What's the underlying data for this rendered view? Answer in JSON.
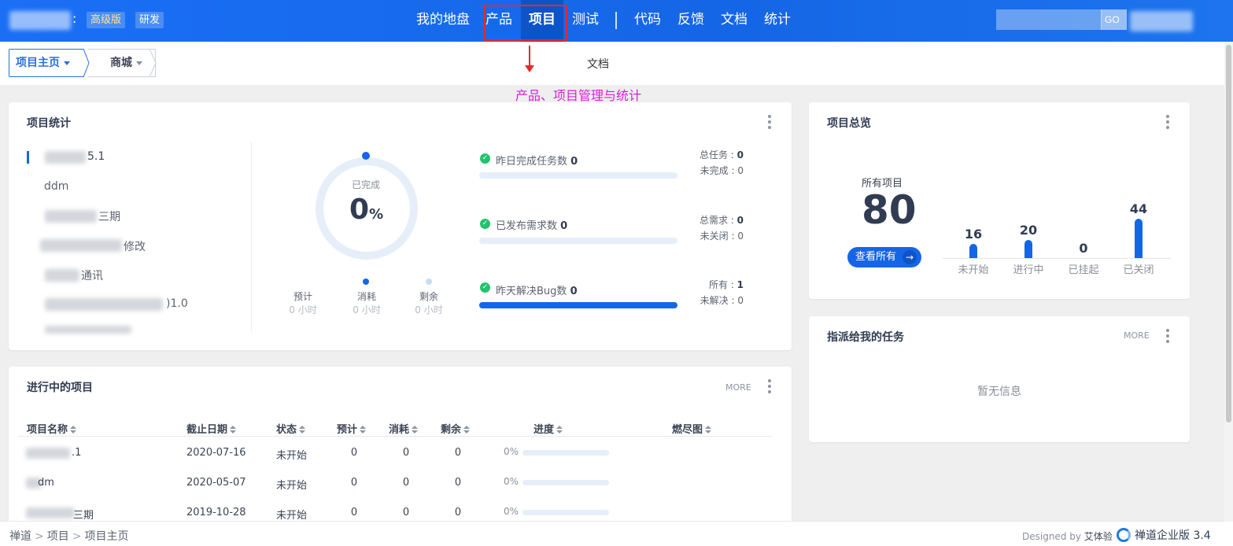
{
  "header": {
    "badge_pro": "高级版",
    "badge_dev": "研发",
    "nav": [
      "我的地盘",
      "产品",
      "项目",
      "测试",
      "代码",
      "反馈",
      "文档",
      "统计"
    ],
    "search_button": "GO"
  },
  "subheader": {
    "crumb_main": "项目主页",
    "crumb_sub": "商城",
    "doc_link": "文档"
  },
  "annotation": {
    "text": "产品、项目管理与统计",
    "color": "#d81ed6"
  },
  "project_stats": {
    "title": "项目统计",
    "projects": [
      "5.1",
      "ddm",
      "三期",
      "修改",
      "通讯",
      ")1.0",
      "..."
    ],
    "ring": {
      "label": "已完成",
      "value": "0",
      "unit": "%"
    },
    "estimate": {
      "label": "预计",
      "value": "0 小时"
    },
    "consumed": {
      "label": "消耗",
      "value": "0 小时"
    },
    "left": {
      "label": "剩余",
      "value": "0 小时"
    },
    "tasks_yesterday": {
      "label": "昨日完成任务数",
      "value": "0",
      "progress": 0
    },
    "stories_published": {
      "label": "已发布需求数",
      "value": "0",
      "progress": 0
    },
    "bugs_resolved": {
      "label": "昨天解决Bug数",
      "value": "0",
      "progress": 100
    },
    "kv_tasks": {
      "total_label": "总任务 : ",
      "total": "0",
      "undone_label": "未完成 : ",
      "undone": "0"
    },
    "kv_stories": {
      "total_label": "总需求 : ",
      "total": "0",
      "open_label": "未关闭 : ",
      "open": "0"
    },
    "kv_bugs": {
      "all_label": "所有 : ",
      "all": "1",
      "unresolved_label": "未解决 : ",
      "unresolved": "0"
    }
  },
  "overview": {
    "title": "项目总览",
    "all_label": "所有项目",
    "all_count": "80",
    "view_all": "查看所有",
    "bars": [
      {
        "label": "未开始",
        "value": 16
      },
      {
        "label": "进行中",
        "value": 20
      },
      {
        "label": "已挂起",
        "value": 0
      },
      {
        "label": "已关闭",
        "value": 44
      }
    ]
  },
  "my_tasks": {
    "title": "指派给我的任务",
    "more": "MORE",
    "empty": "暂无信息"
  },
  "ongoing": {
    "title": "进行中的项目",
    "more": "MORE",
    "columns": [
      "项目名称",
      "截止日期",
      "状态",
      "预计",
      "消耗",
      "剩余",
      "进度",
      "燃尽图"
    ],
    "rows": [
      {
        "name": ".1",
        "deadline": "2020-07-16",
        "status": "未开始",
        "estimate": "0",
        "consumed": "0",
        "left": "0",
        "progress": "0%"
      },
      {
        "name": "dm",
        "deadline": "2020-05-07",
        "status": "未开始",
        "estimate": "0",
        "consumed": "0",
        "left": "0",
        "progress": "0%"
      },
      {
        "name": "三期",
        "deadline": "2019-10-28",
        "status": "未开始",
        "estimate": "0",
        "consumed": "0",
        "left": "0",
        "progress": "0%"
      }
    ]
  },
  "footer": {
    "crumbs": [
      "禅道",
      "项目",
      "项目主页"
    ],
    "designed_by": "Designed by",
    "designer": "艾体验",
    "product": "禅道企业版 3.4"
  }
}
